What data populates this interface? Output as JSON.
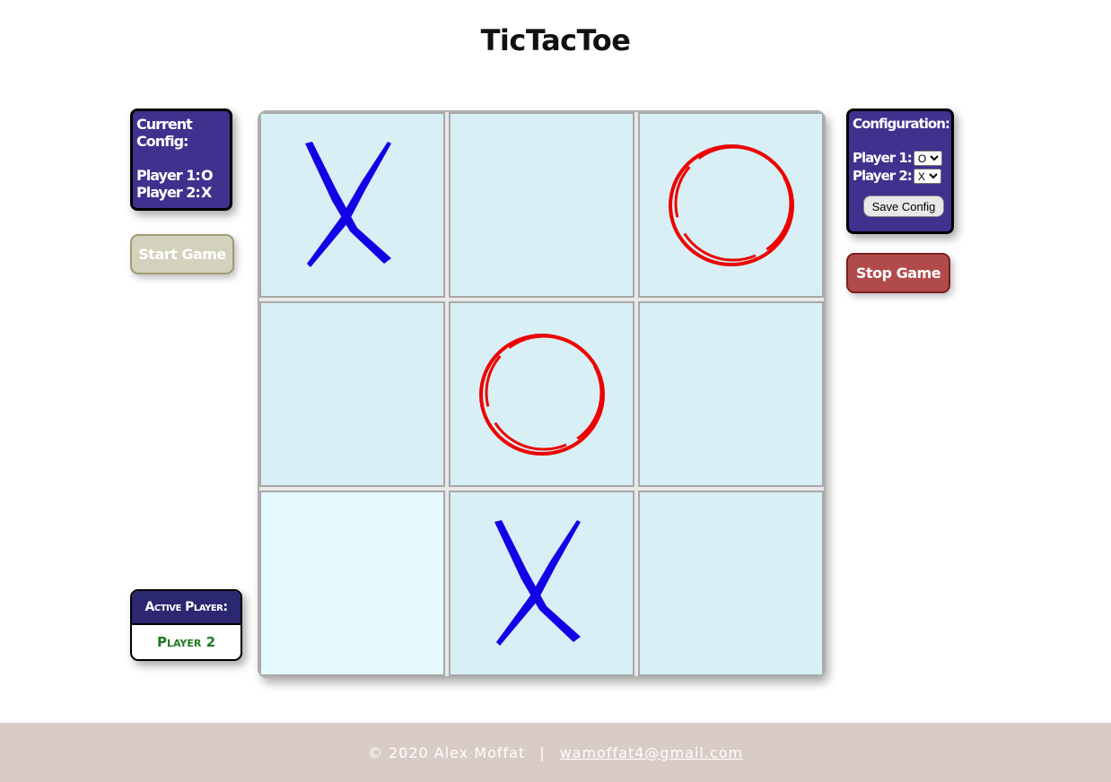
{
  "title": "TicTacToe",
  "current_config": {
    "heading": "Current Config:",
    "player1_label": "Player 1:",
    "player1_value": "O",
    "player2_label": "Player 2:",
    "player2_value": "X"
  },
  "start_button": "Start Game",
  "active_player": {
    "heading": "Active Player:",
    "value": "Player 2"
  },
  "board": [
    {
      "mark": "X"
    },
    {
      "mark": ""
    },
    {
      "mark": "O"
    },
    {
      "mark": ""
    },
    {
      "mark": "O"
    },
    {
      "mark": ""
    },
    {
      "mark": ""
    },
    {
      "mark": "X"
    },
    {
      "mark": ""
    }
  ],
  "colors": {
    "x_mark": "#1400e6",
    "o_mark": "#ee0000"
  },
  "configuration": {
    "heading": "Configuration:",
    "player1_label": "Player 1:",
    "player1_selected": "O",
    "player2_label": "Player 2:",
    "player2_selected": "X",
    "save_label": "Save Config"
  },
  "stop_button": "Stop Game",
  "footer": {
    "copyright": "© 2020 Alex Moffat",
    "separator": "|",
    "email": "wamoffat4@gmail.com"
  }
}
